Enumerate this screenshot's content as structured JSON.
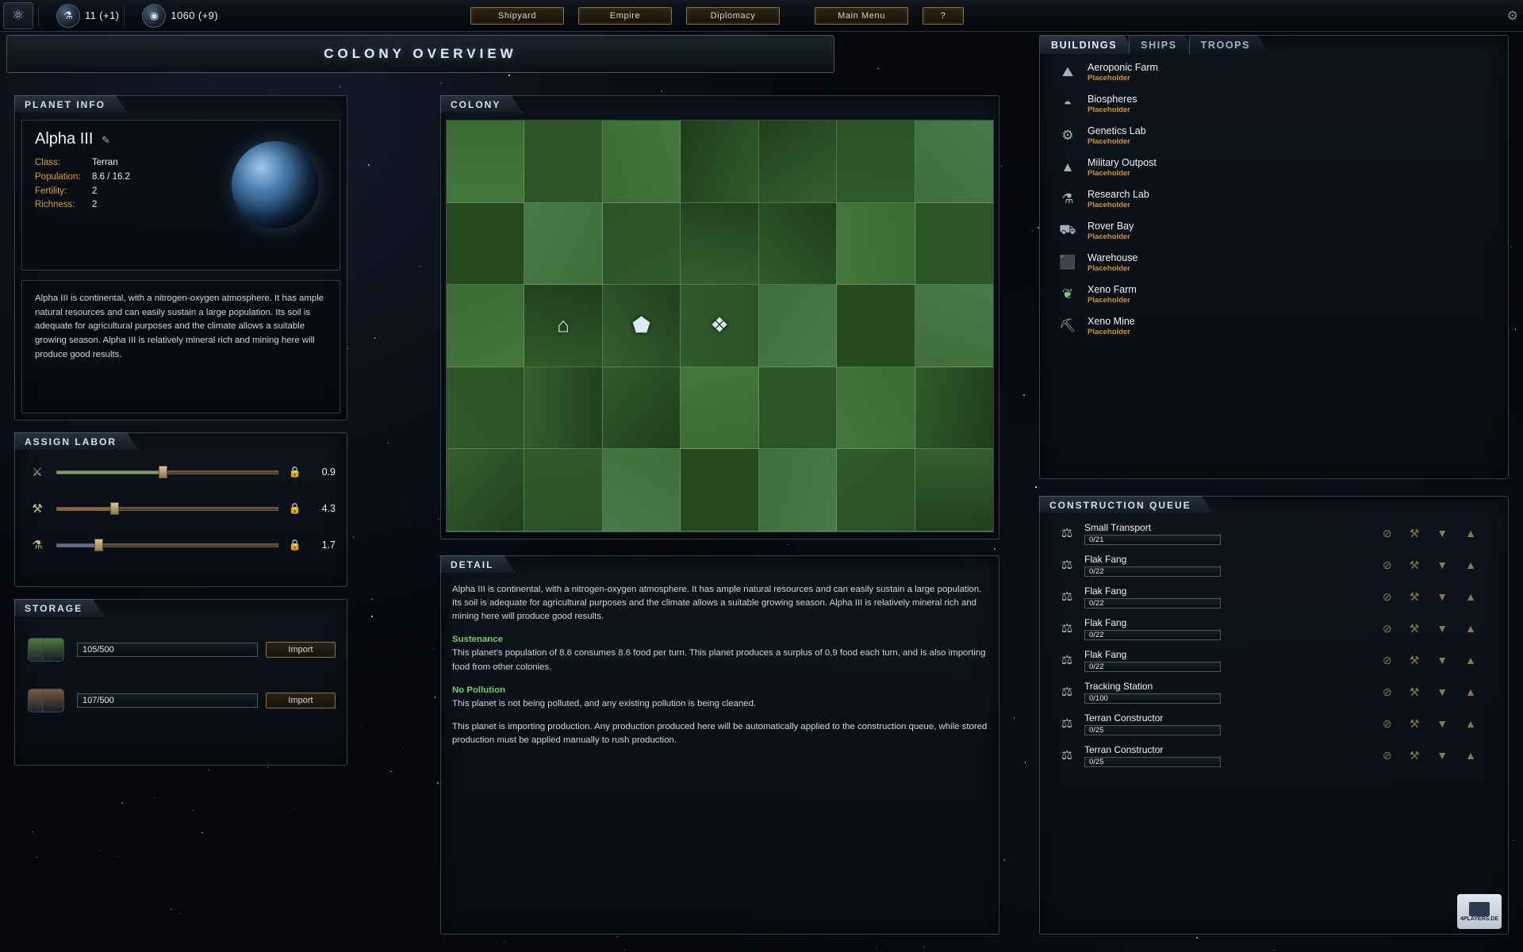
{
  "topbar": {
    "left_icon": "fleet-icon",
    "resources": [
      {
        "icon": "research-icon",
        "value": "11 (+1)"
      },
      {
        "icon": "credits-icon",
        "value": "1060 (+9)"
      }
    ],
    "nav": [
      {
        "label": "Shipyard",
        "name": "shipyard"
      },
      {
        "label": "Empire",
        "name": "empire"
      },
      {
        "label": "Diplomacy",
        "name": "diplomacy"
      },
      {
        "label": "Main Menu",
        "name": "main-menu"
      },
      {
        "label": "?",
        "name": "help"
      }
    ]
  },
  "header": {
    "title": "COLONY OVERVIEW"
  },
  "planet_info": {
    "tab": "PLANET INFO",
    "name": "Alpha III",
    "edit_icon": "pencil-icon",
    "stats": [
      {
        "key": "Class:",
        "value": "Terran"
      },
      {
        "key": "Population:",
        "value": "8.6 / 16.2"
      },
      {
        "key": "Fertility:",
        "value": "2"
      },
      {
        "key": "Richness:",
        "value": "2"
      }
    ],
    "description": "Alpha III is continental, with a nitrogen-oxygen atmosphere. It has ample natural resources and can easily sustain a large population. Its soil is adequate for agricultural purposes and the climate allows a suitable growing season.  Alpha III is relatively mineral rich and mining here will produce good results."
  },
  "assign_labor": {
    "tab": "ASSIGN LABOR",
    "rows": [
      {
        "icon": "food-icon",
        "percent": 48,
        "fill_color": "#6fa86f",
        "lock": "lock-icon",
        "value": "0.9"
      },
      {
        "icon": "production-icon",
        "percent": 26,
        "fill_color": "#8a6a3a",
        "lock": "lock-icon",
        "value": "4.3"
      },
      {
        "icon": "research-icon",
        "percent": 19,
        "fill_color": "#5a6ab0",
        "lock": "lock-icon",
        "value": "1.7"
      }
    ]
  },
  "storage": {
    "tab": "STORAGE",
    "rows": [
      {
        "icon": "food-barrel-icon",
        "value": "105/500",
        "button": "Import",
        "color": "#4e7a3c"
      },
      {
        "icon": "ore-barrel-icon",
        "value": "107/500",
        "button": "Import",
        "color": "#7a5a3c"
      }
    ]
  },
  "colony": {
    "tab": "COLONY",
    "grid_cols": 7,
    "grid_rows": 5,
    "tiles": [
      {
        "index": 16,
        "icon": "dome-building-icon",
        "glyph": "⬟"
      },
      {
        "index": 15,
        "icon": "factory-building-icon",
        "glyph": "⌂"
      },
      {
        "index": 17,
        "icon": "crystal-building-icon",
        "glyph": "❖"
      }
    ]
  },
  "detail": {
    "tab": "DETAIL",
    "intro": "Alpha III is continental, with a nitrogen-oxygen atmosphere. It has ample natural resources and can easily sustain a large population. Its soil is adequate for agricultural purposes and the climate allows a suitable growing season. Alpha III is relatively mineral rich and mining here will produce good results.",
    "sustenance_title": "Sustenance",
    "sustenance_text": "This planet's population of 8.6 consumes 8.6 food per turn. This planet produces a surplus of 0.9 food each turn, and is also importing food from other colonies.",
    "pollution_title": "No Pollution",
    "pollution_text": "This planet is not being polluted, and any existing pollution is being cleaned.",
    "production_text": "This planet is importing production. Any production produced here will be automatically applied to the construction queue, while stored production must be applied manually to rush production."
  },
  "right_tabs": [
    {
      "label": "BUILDINGS",
      "active": true
    },
    {
      "label": "SHIPS",
      "active": false
    },
    {
      "label": "TROOPS",
      "active": false
    }
  ],
  "buildings": [
    {
      "name": "Aeroponic Farm",
      "sub": "Placeholder",
      "icon": "farm-icon",
      "glyph": "⛰",
      "color": "#9fb0bf"
    },
    {
      "name": "Biospheres",
      "sub": "Placeholder",
      "icon": "biosphere-icon",
      "glyph": "◓",
      "color": "#9fb0bf"
    },
    {
      "name": "Genetics Lab",
      "sub": "Placeholder",
      "icon": "genetics-icon",
      "glyph": "⚙",
      "color": "#9fb0bf"
    },
    {
      "name": "Military Outpost",
      "sub": "Placeholder",
      "icon": "outpost-icon",
      "glyph": "▲",
      "color": "#9fb0bf"
    },
    {
      "name": "Research Lab",
      "sub": "Placeholder",
      "icon": "research-lab-icon",
      "glyph": "⚗",
      "color": "#9fb0bf"
    },
    {
      "name": "Rover Bay",
      "sub": "Placeholder",
      "icon": "rover-icon",
      "glyph": "⛟",
      "color": "#9fb0bf"
    },
    {
      "name": "Warehouse",
      "sub": "Placeholder",
      "icon": "warehouse-icon",
      "glyph": "⬛",
      "color": "#9fb0bf"
    },
    {
      "name": "Xeno Farm",
      "sub": "Placeholder",
      "icon": "xeno-farm-icon",
      "glyph": "❦",
      "color": "#7ec97e"
    },
    {
      "name": "Xeno Mine",
      "sub": "Placeholder",
      "icon": "xeno-mine-icon",
      "glyph": "⛏",
      "color": "#9fb0bf"
    }
  ],
  "construction_queue": {
    "tab": "CONSTRUCTION QUEUE",
    "actions": [
      "cancel-icon",
      "rush-icon",
      "move-down-icon",
      "move-up-icon"
    ],
    "action_glyphs": [
      "⊘",
      "⚒",
      "▼",
      "▲"
    ],
    "items": [
      {
        "name": "Small Transport",
        "progress": "0/21",
        "icon": "ship-icon"
      },
      {
        "name": "Flak Fang",
        "progress": "0/22",
        "icon": "ship-icon"
      },
      {
        "name": "Flak Fang",
        "progress": "0/22",
        "icon": "ship-icon"
      },
      {
        "name": "Flak Fang",
        "progress": "0/22",
        "icon": "ship-icon"
      },
      {
        "name": "Flak Fang",
        "progress": "0/22",
        "icon": "ship-icon"
      },
      {
        "name": "Tracking Station",
        "progress": "0/100",
        "icon": "building-icon"
      },
      {
        "name": "Terran Constructor",
        "progress": "0/25",
        "icon": "ship-icon"
      },
      {
        "name": "Terran Constructor",
        "progress": "0/25",
        "icon": "ship-icon"
      }
    ]
  },
  "watermark": {
    "text": "4PLAYERS.DE"
  }
}
